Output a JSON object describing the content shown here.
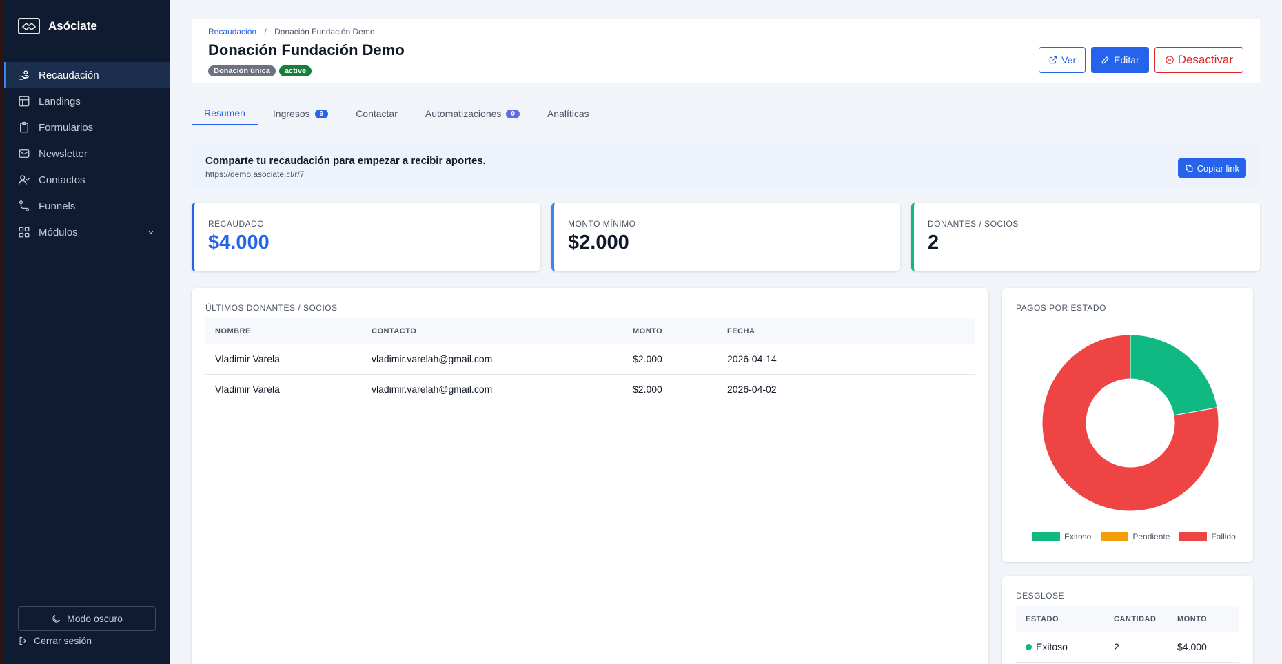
{
  "app": {
    "name": "Asóciate"
  },
  "sidebar": {
    "items": [
      {
        "label": "Recaudación",
        "icon": "hand-coins-icon",
        "active": true
      },
      {
        "label": "Landings",
        "icon": "layout-icon"
      },
      {
        "label": "Formularios",
        "icon": "clipboard-icon"
      },
      {
        "label": "Newsletter",
        "icon": "mail-icon"
      },
      {
        "label": "Contactos",
        "icon": "user-check-icon"
      },
      {
        "label": "Funnels",
        "icon": "route-icon"
      },
      {
        "label": "Módulos",
        "icon": "grid-icon"
      }
    ],
    "dark_mode_label": "Modo oscuro",
    "logout_label": "Cerrar sesión"
  },
  "header": {
    "breadcrumb_parent": "Recaudación",
    "breadcrumb_separator": "/",
    "breadcrumb_current": "Donación Fundación Demo",
    "title": "Donación Fundación Demo",
    "badge_type": "Donación única",
    "badge_status": "active",
    "view_label": "Ver",
    "edit_label": "Editar",
    "deactivate_label": "Desactivar"
  },
  "tabs": [
    {
      "label": "Resumen",
      "active": true
    },
    {
      "label": "Ingresos",
      "count": "9"
    },
    {
      "label": "Contactar"
    },
    {
      "label": "Automatizaciones",
      "count": "0"
    },
    {
      "label": "Analíticas"
    }
  ],
  "share": {
    "title": "Comparte tu recaudación para empezar a recibir aportes.",
    "url": "https://demo.asociate.cl/r/7",
    "copy_label": "Copiar link"
  },
  "stats": [
    {
      "label": "RECAUDADO",
      "value": "$4.000"
    },
    {
      "label": "MONTO MÍNIMO",
      "value": "$2.000"
    },
    {
      "label": "DONANTES / SOCIOS",
      "value": "2"
    }
  ],
  "donors": {
    "title": "ÚLTIMOS DONANTES / SOCIOS",
    "columns": [
      "NOMBRE",
      "CONTACTO",
      "MONTO",
      "FECHA"
    ],
    "rows": [
      [
        "Vladimir Varela",
        "vladimir.varelah@gmail.com",
        "$2.000",
        "2026-04-14"
      ],
      [
        "Vladimir Varela",
        "vladimir.varelah@gmail.com",
        "$2.000",
        "2026-04-02"
      ]
    ]
  },
  "payments": {
    "title": "PAGOS POR ESTADO",
    "chart_data": {
      "type": "pie",
      "donut": true,
      "categories": [
        "Exitoso",
        "Pendiente",
        "Fallido"
      ],
      "values": [
        2,
        0,
        7
      ],
      "colors": [
        "#10b981",
        "#f59e0b",
        "#ef4444"
      ],
      "legend_position": "bottom"
    }
  },
  "breakdown": {
    "title": "DESGLOSE",
    "columns": [
      "ESTADO",
      "CANTIDAD",
      "MONTO"
    ],
    "rows": [
      [
        "Exitoso",
        "2",
        "$4.000"
      ]
    ]
  },
  "colors": {
    "primary": "#2563eb",
    "danger": "#dc2626",
    "success": "#10b981",
    "sidebar_bg": "#0f1b31"
  }
}
